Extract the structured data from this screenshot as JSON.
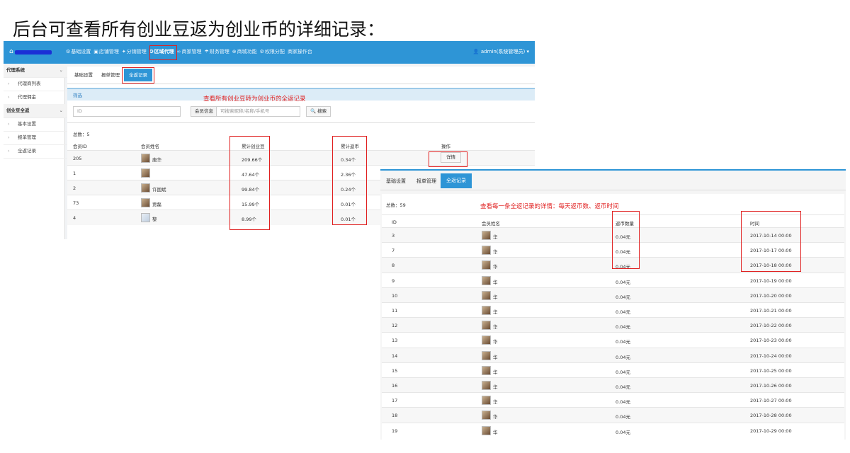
{
  "title": "后台可查看所有创业豆返为创业币的详细记录：",
  "shot1": {
    "nav": [
      {
        "icon": "gear-icon",
        "glyph": "⚙",
        "label": "基础设置"
      },
      {
        "icon": "store-icon",
        "glyph": "▣",
        "label": "店铺管理"
      },
      {
        "icon": "share-icon",
        "glyph": "✦",
        "label": "分销管理"
      },
      {
        "icon": "people-icon",
        "glyph": "✪",
        "label": "区域代理"
      },
      {
        "icon": "link-icon",
        "glyph": "∞",
        "label": "商家管理"
      },
      {
        "icon": "umbrella-icon",
        "glyph": "☂",
        "label": "财务管理"
      },
      {
        "icon": "plus-circle-icon",
        "glyph": "⊕",
        "label": "商城功能"
      },
      {
        "icon": "lock-icon",
        "glyph": "⚙",
        "label": "权限分配"
      },
      {
        "icon": "",
        "glyph": "",
        "label": "商家操作台"
      }
    ],
    "admin": "admin(系统管理员)",
    "sidebar": [
      {
        "type": "head",
        "label": "代理系统"
      },
      {
        "type": "sub",
        "label": "代理商列表"
      },
      {
        "type": "sub",
        "label": "代理佣金"
      },
      {
        "type": "head",
        "label": "创业豆全返"
      },
      {
        "type": "sub",
        "label": "基本设置"
      },
      {
        "type": "sub",
        "label": "报单管理"
      },
      {
        "type": "sub",
        "label": "全返记录"
      }
    ],
    "tabs": [
      "基础设置",
      "报单管理",
      "全返记录"
    ],
    "filter_title": "筛选",
    "annotation": "查看所有创业豆转为创业币的全返记录",
    "id_label": "ID",
    "member_label": "会员信息",
    "member_placeholder": "可搜索昵称/名称/手机号",
    "search_button": "搜索",
    "total": "总数：5",
    "columns": [
      "会员ID",
      "会员姓名",
      "累计创业豆",
      "累计返币",
      "操作"
    ],
    "detail_button": "详情",
    "rows": [
      {
        "id": "205",
        "name": "唐华",
        "beans": "209.66个",
        "coins": "0.34个"
      },
      {
        "id": "1",
        "name": "",
        "beans": "47.64个",
        "coins": "2.36个"
      },
      {
        "id": "2",
        "name": "许国斌",
        "beans": "99.84个",
        "coins": "0.24个"
      },
      {
        "id": "73",
        "name": "贾磊",
        "beans": "15.99个",
        "coins": "0.01个"
      },
      {
        "id": "4",
        "name": "黎",
        "beans": "8.99个",
        "coins": "0.01个"
      }
    ]
  },
  "shot2": {
    "tabs": [
      "基础设置",
      "报单管理",
      "全返记录"
    ],
    "total": "总数：59",
    "annotation": "查看每一条全返记录的详情：每天返币数、返币时间",
    "columns": [
      "ID",
      "会员姓名",
      "返币数量",
      "时间"
    ],
    "rows": [
      {
        "id": "3",
        "name": "华",
        "amount": "0.04元",
        "time": "2017-10-14 00:00"
      },
      {
        "id": "7",
        "name": "华",
        "amount": "0.04元",
        "time": "2017-10-17 00:00"
      },
      {
        "id": "8",
        "name": "华",
        "amount": "0.04元",
        "time": "2017-10-18 00:00"
      },
      {
        "id": "9",
        "name": "华",
        "amount": "0.04元",
        "time": "2017-10-19 00:00"
      },
      {
        "id": "10",
        "name": "华",
        "amount": "0.04元",
        "time": "2017-10-20 00:00"
      },
      {
        "id": "11",
        "name": "华",
        "amount": "0.04元",
        "time": "2017-10-21 00:00"
      },
      {
        "id": "12",
        "name": "华",
        "amount": "0.04元",
        "time": "2017-10-22 00:00"
      },
      {
        "id": "13",
        "name": "华",
        "amount": "0.04元",
        "time": "2017-10-23 00:00"
      },
      {
        "id": "14",
        "name": "华",
        "amount": "0.04元",
        "time": "2017-10-24 00:00"
      },
      {
        "id": "15",
        "name": "华",
        "amount": "0.04元",
        "time": "2017-10-25 00:00"
      },
      {
        "id": "16",
        "name": "华",
        "amount": "0.04元",
        "time": "2017-10-26 00:00"
      },
      {
        "id": "17",
        "name": "华",
        "amount": "0.04元",
        "time": "2017-10-27 00:00"
      },
      {
        "id": "18",
        "name": "华",
        "amount": "0.04元",
        "time": "2017-10-28 00:00"
      },
      {
        "id": "19",
        "name": "华",
        "amount": "0.04元",
        "time": "2017-10-29 00:00"
      }
    ]
  },
  "colors": {
    "brand_blue": "#2e95d6",
    "annotation_red": "#e02020"
  }
}
